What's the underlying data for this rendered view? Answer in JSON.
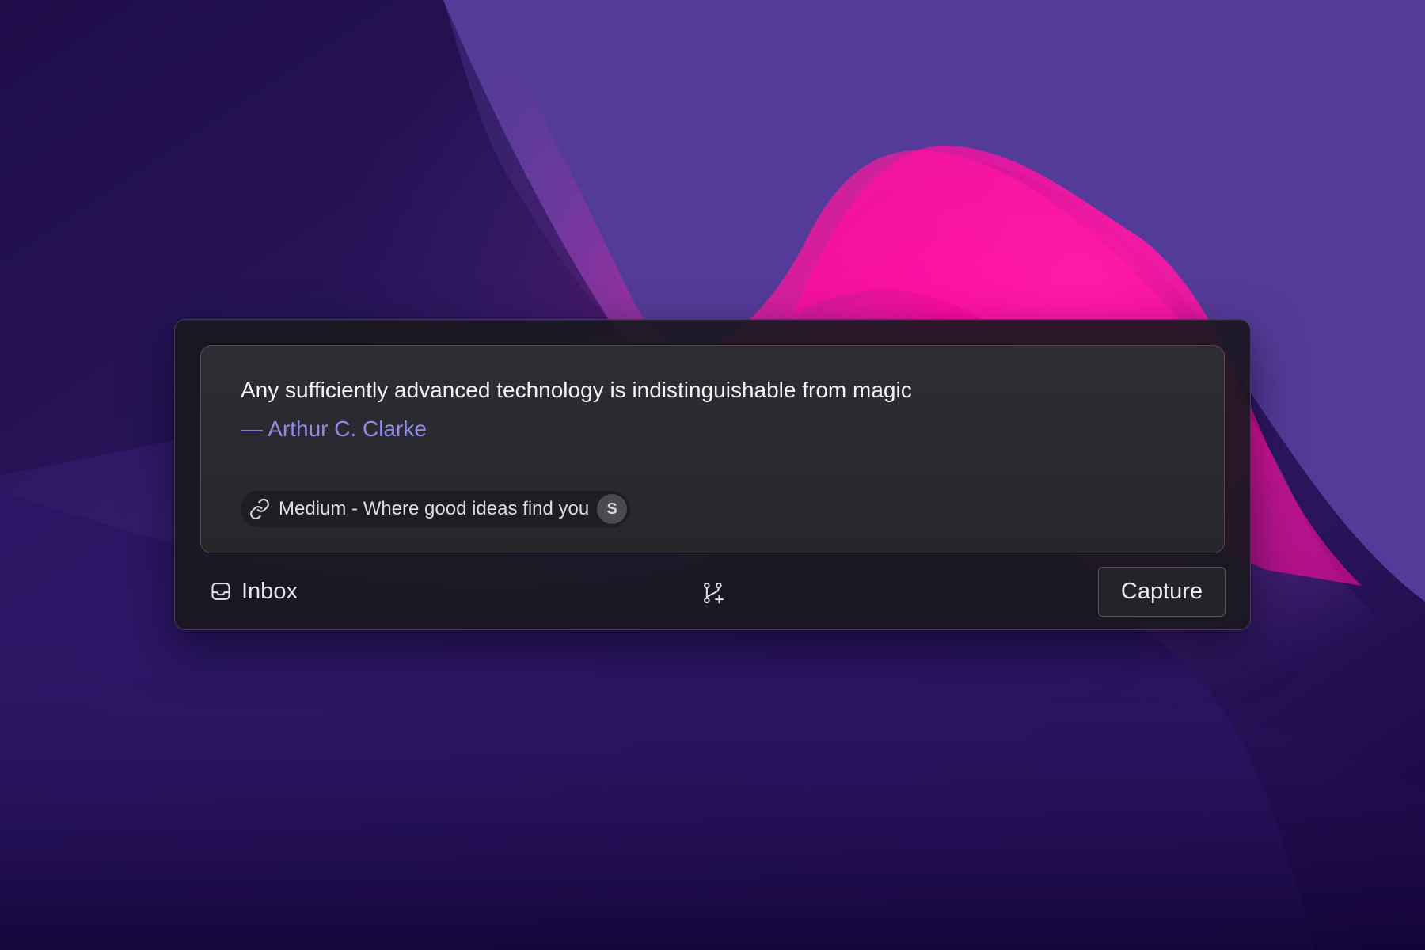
{
  "note": {
    "quote": "Any sufficiently advanced technology is indistinguishable from magic",
    "author": "— Arthur C. Clarke",
    "source": {
      "label": "Medium - Where good ideas find you",
      "icon": "link-icon",
      "avatar_letter": "S"
    }
  },
  "footer": {
    "inbox_label": "Inbox",
    "inbox_icon": "inbox-icon",
    "branch_icon": "git-branch-plus-icon",
    "capture_label": "Capture"
  },
  "colors": {
    "author_accent": "#8f8ce6",
    "wallpaper_pink": "#ff0a9c",
    "wallpaper_purple": "#553b99",
    "wallpaper_dark": "#140536"
  }
}
